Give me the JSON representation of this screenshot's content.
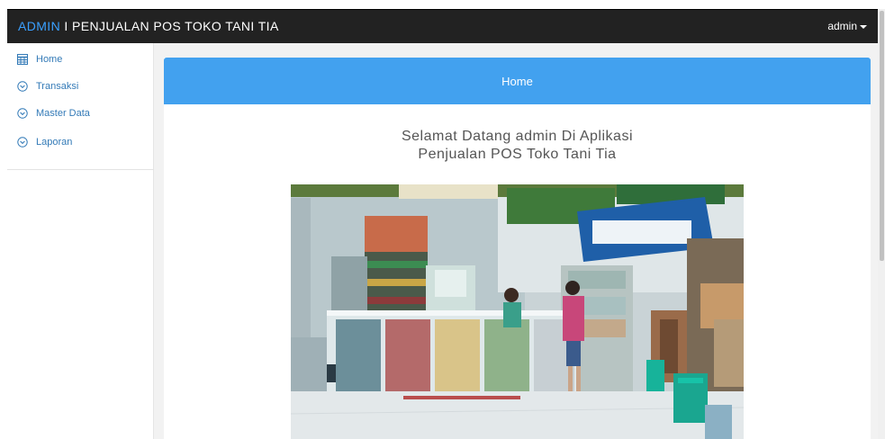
{
  "app": {
    "brand_prefix": "ADMIN",
    "brand_sep": " I ",
    "brand_title": "PENJUALAN POS TOKO TANI TIA",
    "user": "admin"
  },
  "sidebar": {
    "items": [
      {
        "label": "Home",
        "icon": "table-icon"
      },
      {
        "label": "Transaksi",
        "icon": "chevron-circle-icon"
      },
      {
        "label": "Master Data",
        "icon": "chevron-circle-icon"
      },
      {
        "label": "Laporan",
        "icon": "chevron-circle-icon"
      }
    ]
  },
  "main": {
    "heading": "Home",
    "welcome_line1": "Selamat Datang admin Di Aplikasi",
    "welcome_line2": "Penjualan POS Toko Tani Tia"
  },
  "colors": {
    "topbar": "#222222",
    "accent": "#3aa0ff",
    "panel_heading": "#42a1ef",
    "link": "#337ab7"
  }
}
